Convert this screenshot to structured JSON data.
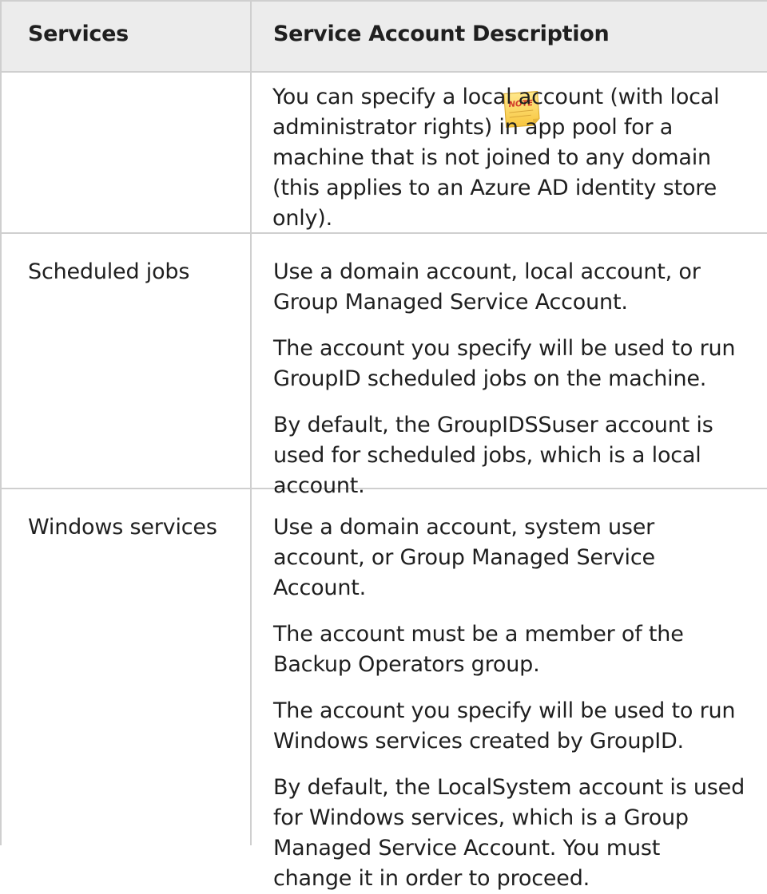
{
  "table": {
    "headers": {
      "services": "Services",
      "description": "Service Account Description"
    },
    "note": {
      "icon": "note-icon",
      "label": "NOTE",
      "text": "You can specify a local account (with local administrator rights) in app pool for a machine that is not joined to any domain (this applies to an Azure AD identity store only)."
    },
    "rows": [
      {
        "service": "Scheduled jobs",
        "paragraphs": [
          "Use a domain account, local account, or Group Managed Service Account.",
          "The account you specify will be used to run GroupID scheduled jobs on the machine.",
          "By default, the GroupIDSSuser account is used for scheduled jobs, which is a local account."
        ]
      },
      {
        "service": "Windows services",
        "paragraphs": [
          "Use a domain account, system user account, or Group Managed Service Account.",
          "The account must be a member of the Backup Operators group.",
          "The account you specify will be used to run Windows services created by GroupID.",
          "By default, the LocalSystem account is used for Windows services, which is a Group Managed Service Account. You must change it in order to proceed."
        ]
      }
    ]
  }
}
